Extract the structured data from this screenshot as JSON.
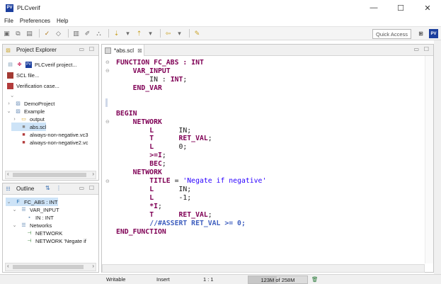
{
  "window": {
    "title": "PLCverif",
    "logo": "PV",
    "controls": [
      "—",
      "☐",
      "✕"
    ]
  },
  "menu": [
    "File",
    "Preferences",
    "Help"
  ],
  "toolbar": {
    "quick_access_label": "Quick Access",
    "icons": [
      "save-icon",
      "save-all-icon",
      "print-icon",
      "back-icon",
      "forward-icon",
      "run-icon",
      "verify-icon",
      "pin-icon",
      "annotation-icon",
      "brush-icon"
    ]
  },
  "project_explorer": {
    "title": "Project Explorer",
    "actions": [
      "PLCverif project...",
      "SCL file...",
      "Verification case..."
    ],
    "tree": [
      {
        "label": "DemoProject",
        "indent": 0,
        "twisty": "›",
        "icon": "project-icon"
      },
      {
        "label": "Example",
        "indent": 0,
        "twisty": "⌄",
        "icon": "project-icon"
      },
      {
        "label": "output",
        "indent": 1,
        "twisty": "›",
        "icon": "folder-icon"
      },
      {
        "label": "abs.scl",
        "indent": 1,
        "twisty": "",
        "icon": "scl-file-icon",
        "selected": true
      },
      {
        "label": "always-non-negative.vc3",
        "indent": 1,
        "twisty": "",
        "icon": "vc-file-icon"
      },
      {
        "label": "always-non-negative2.vc",
        "indent": 1,
        "twisty": "",
        "icon": "vc-file-icon"
      }
    ]
  },
  "outline": {
    "title": "Outline",
    "tree": [
      {
        "label": "FC_ABS : INT",
        "indent": 0,
        "twisty": "⌄",
        "icon": "function-icon",
        "selected": true
      },
      {
        "label": "VAR_INPUT",
        "indent": 1,
        "twisty": "⌄",
        "icon": "var-block-icon"
      },
      {
        "label": "IN : INT",
        "indent": 2,
        "twisty": "",
        "icon": "variable-icon"
      },
      {
        "label": "Networks",
        "indent": 1,
        "twisty": "⌄",
        "icon": "var-block-icon"
      },
      {
        "label": "NETWORK",
        "indent": 2,
        "twisty": "",
        "icon": "network-icon"
      },
      {
        "label": "NETWORK 'Negate if",
        "indent": 2,
        "twisty": "",
        "icon": "network-icon"
      }
    ]
  },
  "editor": {
    "tab_label": "*abs.scl",
    "code": [
      [
        [
          "kw",
          "FUNCTION FC_ABS : INT"
        ]
      ],
      [
        [
          "",
          "    "
        ],
        [
          "kw",
          "VAR_INPUT"
        ]
      ],
      [
        [
          "",
          "        IN : "
        ],
        [
          "kw",
          "INT"
        ],
        [
          "",
          ";"
        ]
      ],
      [
        [
          "",
          "    "
        ],
        [
          "kw",
          "END_VAR"
        ]
      ],
      [
        [
          "",
          ""
        ]
      ],
      [
        [
          "",
          ""
        ]
      ],
      [
        [
          "kw",
          "BEGIN"
        ]
      ],
      [
        [
          "",
          "    "
        ],
        [
          "kw",
          "NETWORK"
        ]
      ],
      [
        [
          "",
          "        "
        ],
        [
          "kw",
          "L"
        ],
        [
          "",
          "      IN;"
        ]
      ],
      [
        [
          "",
          "        "
        ],
        [
          "kw",
          "T"
        ],
        [
          "",
          "      "
        ],
        [
          "kw",
          "RET_VAL"
        ],
        [
          "",
          ";"
        ]
      ],
      [
        [
          "",
          "        "
        ],
        [
          "kw",
          "L"
        ],
        [
          "",
          "      0;"
        ]
      ],
      [
        [
          "",
          "        "
        ],
        [
          "kw",
          ">=I"
        ],
        [
          "",
          ";"
        ]
      ],
      [
        [
          "",
          "        "
        ],
        [
          "kw",
          "BEC"
        ],
        [
          "",
          ";"
        ]
      ],
      [
        [
          "",
          "    "
        ],
        [
          "kw",
          "NETWORK"
        ]
      ],
      [
        [
          "",
          "        "
        ],
        [
          "kw",
          "TITLE"
        ],
        [
          "",
          " = "
        ],
        [
          "str",
          "'Negate if negative'"
        ]
      ],
      [
        [
          "",
          "        "
        ],
        [
          "kw",
          "L"
        ],
        [
          "",
          "      IN;"
        ]
      ],
      [
        [
          "",
          "        "
        ],
        [
          "kw",
          "L"
        ],
        [
          "",
          "      -1;"
        ]
      ],
      [
        [
          "",
          "        "
        ],
        [
          "kw",
          "*I"
        ],
        [
          "",
          ";"
        ]
      ],
      [
        [
          "",
          "        "
        ],
        [
          "kw",
          "T"
        ],
        [
          "",
          "      "
        ],
        [
          "kw",
          "RET_VAL"
        ],
        [
          "",
          ";"
        ]
      ],
      [
        [
          "",
          "        "
        ],
        [
          "cmt",
          "//#ASSERT RET_VAL >= 0;"
        ]
      ],
      [
        [
          "kw",
          "END_FUNCTION"
        ]
      ]
    ]
  },
  "status": {
    "mode": "Writable",
    "insert": "Insert",
    "position": "1 : 1",
    "heap": "123M of 258M",
    "heap_used_fraction": 0.48
  }
}
